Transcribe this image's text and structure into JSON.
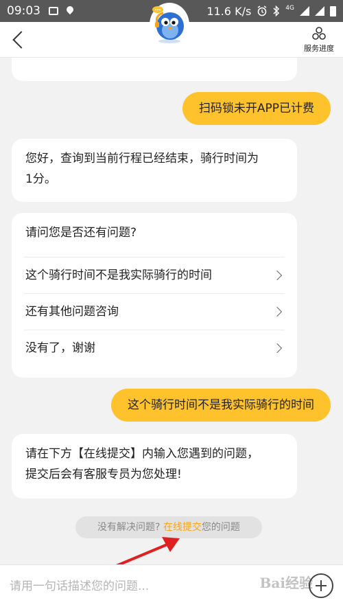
{
  "status_bar": {
    "time": "09:03",
    "speed": "11.6 K/s",
    "network": "4G",
    "icons": [
      "photo-icon",
      "location-icon",
      "alarm-icon",
      "bluetooth-icon",
      "signal-icon",
      "battery-icon"
    ]
  },
  "header": {
    "service_label": "服务进度",
    "icons": [
      "back-icon",
      "bird-mascot-avatar",
      "service-progress-icon"
    ]
  },
  "messages": {
    "user_1": "扫码锁未开APP已计费",
    "bot_1": [
      "您好，查询到当前行程已经结束，骑行时间为",
      "1分。"
    ],
    "menu_title": "请问您是否还有问题?",
    "menu_items": [
      "这个骑行时间不是我实际骑行的时间",
      "还有其他问题咨询",
      "没有了，谢谢"
    ],
    "user_2": "这个骑行时间不是我实际骑行的时间",
    "bot_2": [
      "请在下方【在线提交】内输入您遇到的问题，",
      "提交后会有客服专员为您处理!"
    ]
  },
  "tip": {
    "prefix": "没有解决问题?",
    "link": "在线提交",
    "suffix": "您的问题"
  },
  "input_bar": {
    "placeholder": "请用一句话描述您的问题...",
    "watermark": "Bai经验"
  },
  "colors": {
    "accent_yellow": "#fdc22c",
    "link_orange": "#f5a623",
    "annotation_red": "#e02020"
  }
}
